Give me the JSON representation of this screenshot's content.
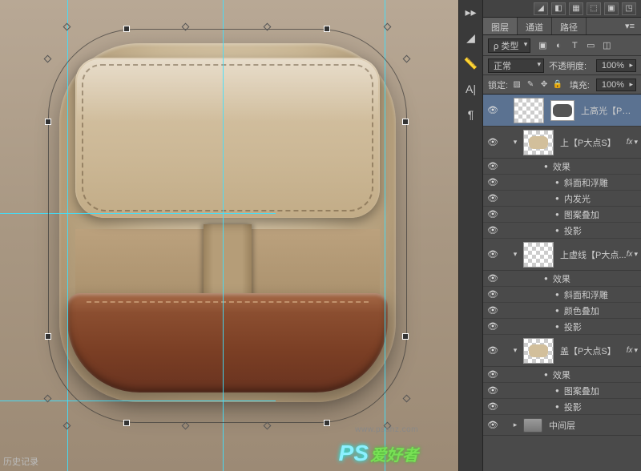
{
  "watermark": {
    "ps": "PS",
    "cn": "爱好者",
    "url": "www.psahz.com"
  },
  "history_label": "历史记录",
  "sidebar_tools": [
    "tri",
    "ruler",
    "A",
    "swatch"
  ],
  "toprow_icons": [
    "◢",
    "◧",
    "▦",
    "⬚",
    "▣",
    "◳"
  ],
  "panel": {
    "tabs": {
      "layers": "图层",
      "channels": "通道",
      "paths": "路径"
    },
    "filter": {
      "kind": "ρ 类型"
    },
    "blend": {
      "mode": "正常",
      "opacity_label": "不透明度:",
      "opacity": "100%"
    },
    "lock": {
      "label": "锁定:",
      "fill_label": "填充:",
      "fill": "100%"
    },
    "filter_icons": [
      "▣",
      "◯",
      "T",
      "▭",
      "◫"
    ]
  },
  "layers": [
    {
      "id": "l1",
      "name": "上高光【P大点S】",
      "selected": true,
      "thumb": "blank"
    },
    {
      "id": "l2",
      "name": "上【P大点S】",
      "fx": true,
      "thumb": "tan-round",
      "effects": [
        "效果",
        "斜面和浮雕",
        "内发光",
        "图案叠加",
        "投影"
      ]
    },
    {
      "id": "l3",
      "name": "上虚线【P大点...",
      "fx": true,
      "thumb": "blank",
      "effects": [
        "效果",
        "斜面和浮雕",
        "颜色叠加",
        "投影"
      ]
    },
    {
      "id": "l4",
      "name": "盖【P大点S】",
      "fx": true,
      "thumb": "tan-round",
      "effects": [
        "效果",
        "图案叠加",
        "投影"
      ]
    },
    {
      "id": "folder",
      "name": "中间层",
      "folder": true
    }
  ]
}
